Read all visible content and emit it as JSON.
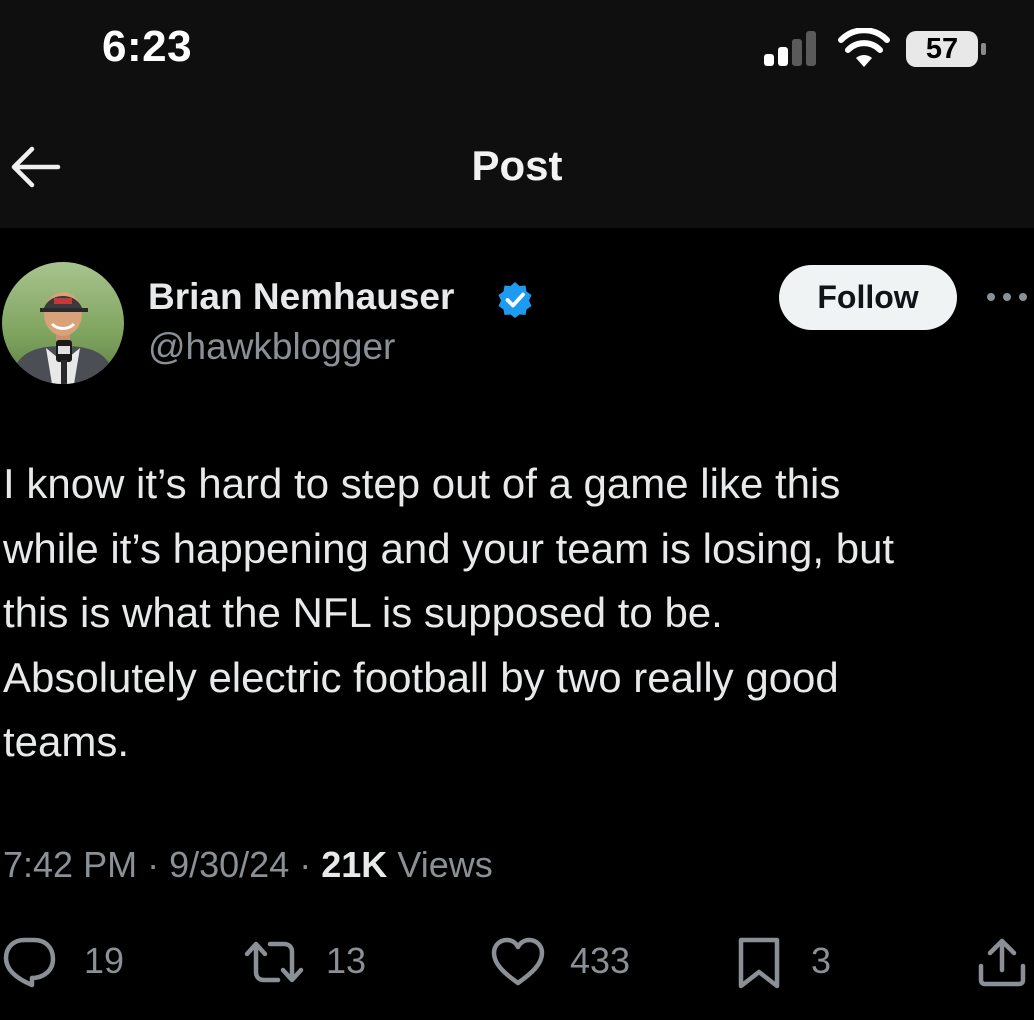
{
  "status_bar": {
    "time": "6:23",
    "battery": "57",
    "signal_icon": "cellular-signal-icon",
    "wifi_icon": "wifi-icon"
  },
  "header": {
    "title": "Post",
    "back_icon": "back-arrow-icon"
  },
  "author": {
    "name": "Brian Nemhauser",
    "handle": "@hawkblogger",
    "verified": true,
    "follow_label": "Follow"
  },
  "tweet": {
    "text": "I know it’s hard to step out of a game like this\nwhile it’s happening and your team is losing, but\nthis is what the NFL is supposed to be.\nAbsolutely electric football by two really good\nteams."
  },
  "meta": {
    "time": "7:42 PM",
    "separator": "·",
    "date": "9/30/24",
    "views_count": "21K",
    "views_label": "Views"
  },
  "actions": {
    "replies": "19",
    "reposts": "13",
    "likes": "433",
    "bookmarks": "3"
  },
  "colors": {
    "background": "#000000",
    "header_background": "#0f0f0f",
    "primary_text": "#e7e9ea",
    "secondary_text": "#8b9096",
    "verified_blue": "#1d9bf0",
    "follow_button": "#eff3f4"
  }
}
